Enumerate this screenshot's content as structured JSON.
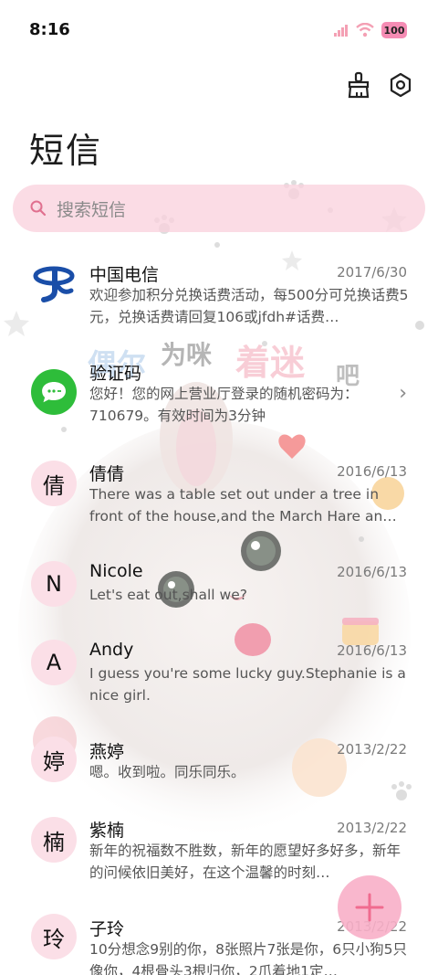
{
  "status_bar": {
    "time": "8:16",
    "battery": "100"
  },
  "header": {
    "title": "短信",
    "icons": [
      "broom-icon",
      "settings-icon"
    ]
  },
  "search": {
    "placeholder": "搜索短信"
  },
  "decoration": {
    "watermark_words": [
      "偶尔",
      "为咪",
      "着迷",
      "吧"
    ]
  },
  "colors": {
    "accent_pink": "#f8afc8",
    "avatar_bg": "#fbdfe7",
    "telecom_blue": "#1a4ea8",
    "verify_green": "#2ebd3a"
  },
  "messages": [
    {
      "name": "中国电信",
      "date": "2017/6/30",
      "snippet": "欢迎参加积分兑换话费活动，每500分可兑换话费5元，兑换话费请回复106或jfdh#话费…",
      "avatar_type": "telecom-logo"
    },
    {
      "name": "验证码",
      "date": "",
      "snippet": "您好！您的网上营业厅登录的随机密码为：710679。有效时间为3分钟",
      "avatar_type": "chat-bubble-icon"
    },
    {
      "name": "倩倩",
      "date": "2016/6/13",
      "snippet": "There was a table set out under a tree in front of the house,and the March Hare an…",
      "avatar_char": "倩"
    },
    {
      "name": "Nicole",
      "date": "2016/6/13",
      "snippet": "Let's eat out,shall we?",
      "avatar_char": "N"
    },
    {
      "name": "Andy",
      "date": "2016/6/13",
      "snippet": "I guess you're some lucky guy.Stephanie is a nice girl.",
      "avatar_char": "A"
    },
    {
      "name": "燕婷",
      "date": "2013/2/22",
      "snippet": "嗯。收到啦。同乐同乐。",
      "avatar_char": "婷"
    },
    {
      "name": "紫楠",
      "date": "2013/2/22",
      "snippet": "新年的祝福数不胜数，新年的愿望好多好多，新年的问候依旧美好，在这个温馨的时刻…",
      "avatar_char": "楠"
    },
    {
      "name": "子玲",
      "date": "2013/2/22",
      "snippet": "10分想念9别的你，8张照片7张是你，6只小狗5只像你，4根骨头3根归你，2爪着地1定…",
      "avatar_char": "玲"
    }
  ]
}
